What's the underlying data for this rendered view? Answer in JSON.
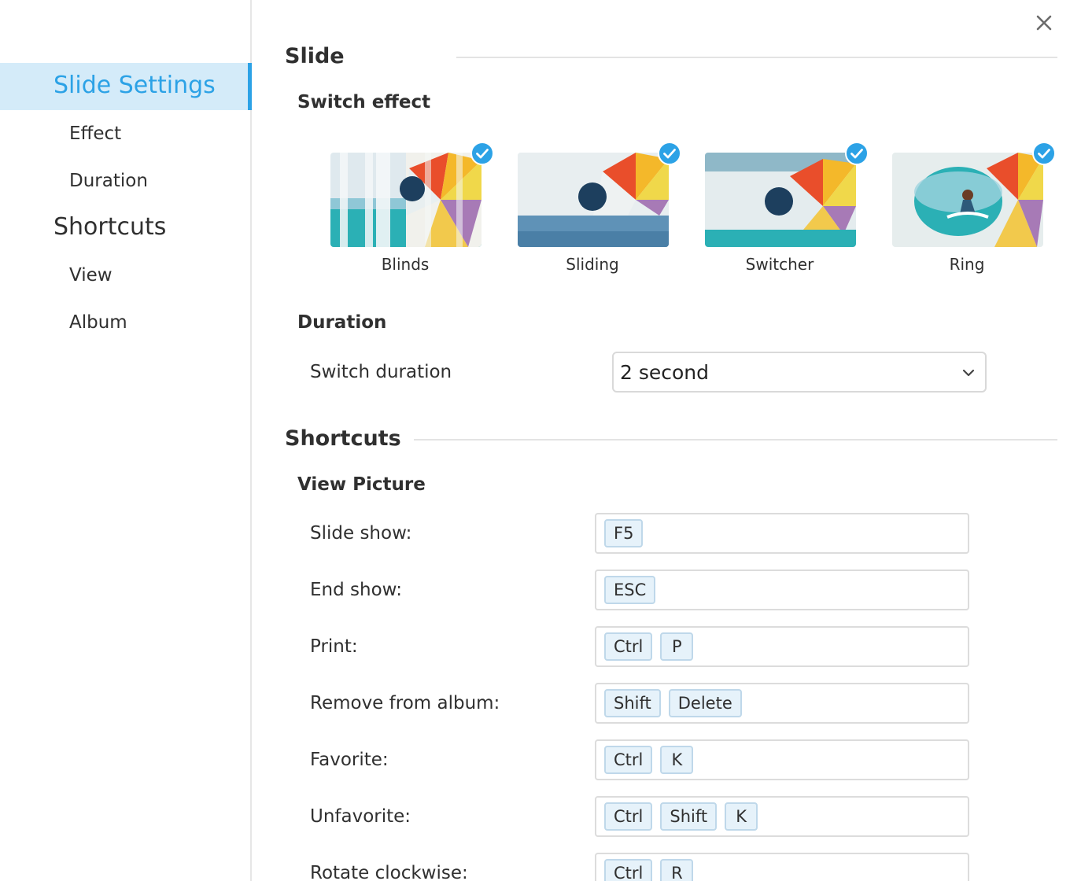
{
  "sidebar": {
    "groups": [
      {
        "title": "Slide Settings",
        "items": [
          "Effect",
          "Duration"
        ]
      },
      {
        "title": "Shortcuts",
        "items": [
          "View",
          "Album"
        ]
      }
    ]
  },
  "close_icon": "close-icon",
  "slide": {
    "title": "Slide",
    "switch_effect": {
      "heading": "Switch effect",
      "options": [
        {
          "label": "Blinds",
          "selected": true
        },
        {
          "label": "Sliding",
          "selected": true
        },
        {
          "label": "Switcher",
          "selected": true
        },
        {
          "label": "Ring",
          "selected": true
        }
      ]
    },
    "duration": {
      "heading": "Duration",
      "label": "Switch duration",
      "value": "2 second"
    }
  },
  "shortcuts": {
    "title": "Shortcuts",
    "view_picture": {
      "heading": "View Picture",
      "rows": [
        {
          "label": "Slide show:",
          "keys": [
            "F5"
          ]
        },
        {
          "label": "End show:",
          "keys": [
            "ESC"
          ]
        },
        {
          "label": "Print:",
          "keys": [
            "Ctrl",
            "P"
          ]
        },
        {
          "label": "Remove from album:",
          "keys": [
            "Shift",
            "Delete"
          ]
        },
        {
          "label": "Favorite:",
          "keys": [
            "Ctrl",
            "K"
          ]
        },
        {
          "label": "Unfavorite:",
          "keys": [
            "Ctrl",
            "Shift",
            "K"
          ]
        },
        {
          "label": "Rotate clockwise:",
          "keys": [
            "Ctrl",
            "R"
          ]
        }
      ]
    }
  },
  "colors": {
    "accent": "#2ca2e6",
    "active_bg": "#d4ebf9",
    "key_bg": "#e6f2fa",
    "key_border": "#bfd8ea"
  }
}
